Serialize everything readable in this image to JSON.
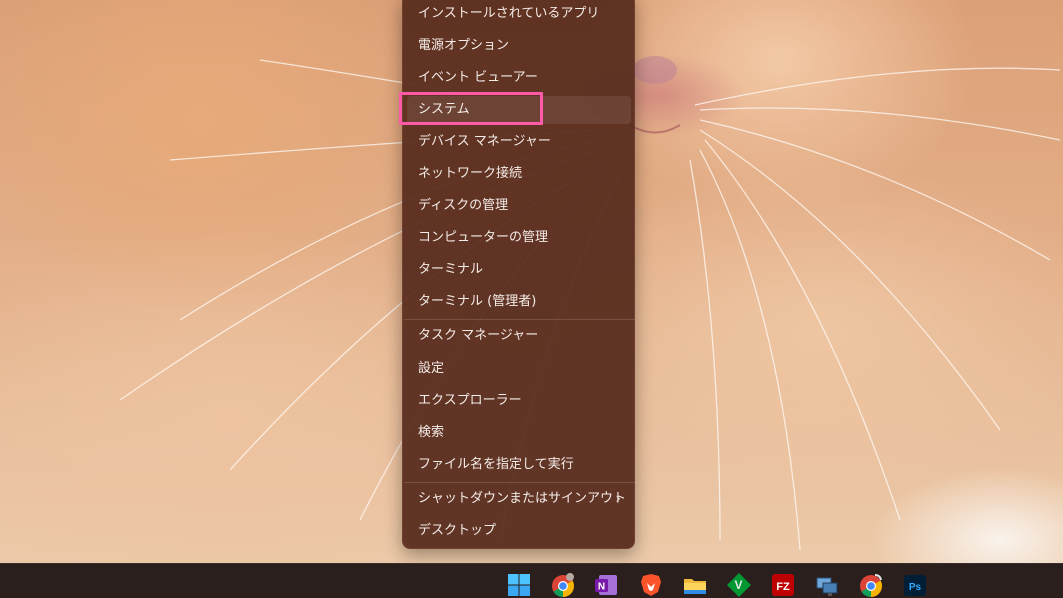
{
  "context_menu": {
    "items": [
      {
        "label": "インストールされているアプリ"
      },
      {
        "label": "電源オプション"
      },
      {
        "label": "イベント ビューアー"
      },
      {
        "label": "システム"
      },
      {
        "label": "デバイス マネージャー"
      },
      {
        "label": "ネットワーク接続"
      },
      {
        "label": "ディスクの管理"
      },
      {
        "label": "コンピューターの管理"
      },
      {
        "label": "ターミナル"
      },
      {
        "label": "ターミナル (管理者)"
      },
      {
        "label": "タスク マネージャー"
      },
      {
        "label": "設定"
      },
      {
        "label": "エクスプローラー"
      },
      {
        "label": "検索"
      },
      {
        "label": "ファイル名を指定して実行"
      },
      {
        "label": "シャットダウンまたはサインアウト"
      },
      {
        "label": "デスクトップ"
      }
    ],
    "highlight_color": "#ff5aa8"
  },
  "taskbar": {
    "icons": [
      {
        "name": "windows-start-icon"
      },
      {
        "name": "chrome-icon"
      },
      {
        "name": "onenote-icon",
        "text": "N"
      },
      {
        "name": "brave-icon"
      },
      {
        "name": "file-explorer-icon"
      },
      {
        "name": "vim-icon",
        "text": "V"
      },
      {
        "name": "filezilla-icon",
        "text": "FZ"
      },
      {
        "name": "remote-desktop-icon"
      },
      {
        "name": "chrome-canary-icon"
      },
      {
        "name": "photoshop-icon",
        "text": "Ps"
      }
    ]
  }
}
